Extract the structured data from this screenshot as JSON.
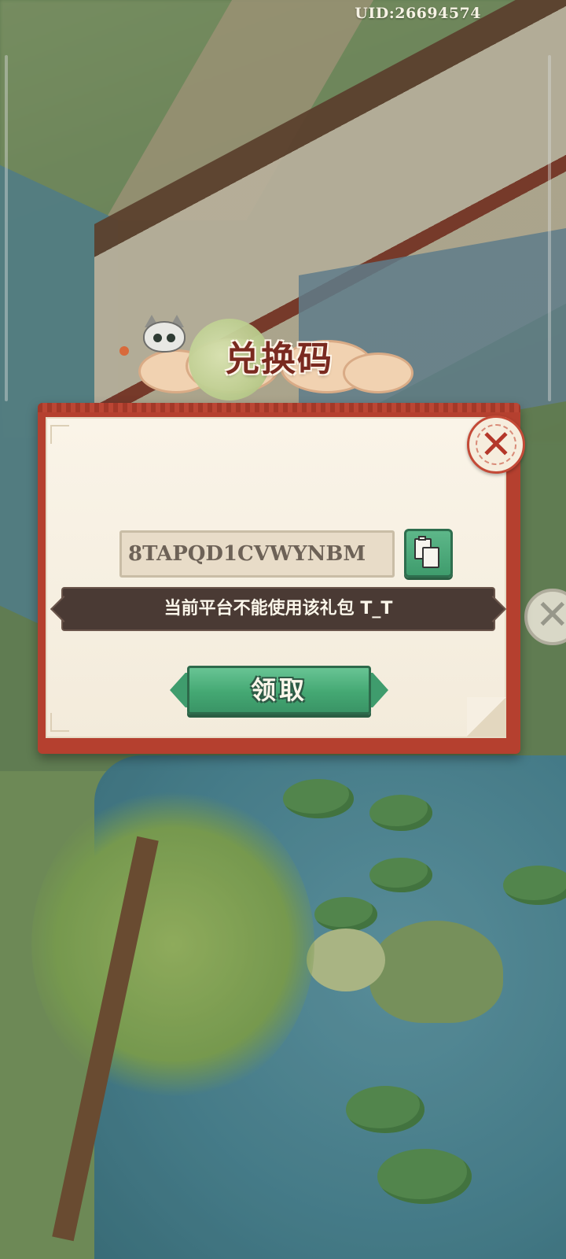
{
  "header": {
    "uid_text": "UID:26694574"
  },
  "dialog": {
    "title": "兑换码",
    "code_value": "8TAPQD1CVWYNBM",
    "message": "当前平台不能使用该礼包 T_T",
    "claim_label": "领取"
  },
  "icons": {
    "close": "close-icon",
    "copy": "clipboard-copy-icon",
    "mascot": "cat-mascot-icon",
    "side_close": "side-close-icon"
  },
  "colors": {
    "frame_red": "#b5402f",
    "paper": "#faf4e8",
    "button_green": "#44a873",
    "message_bg": "#4a3a34",
    "title_text": "#7a2a20"
  }
}
